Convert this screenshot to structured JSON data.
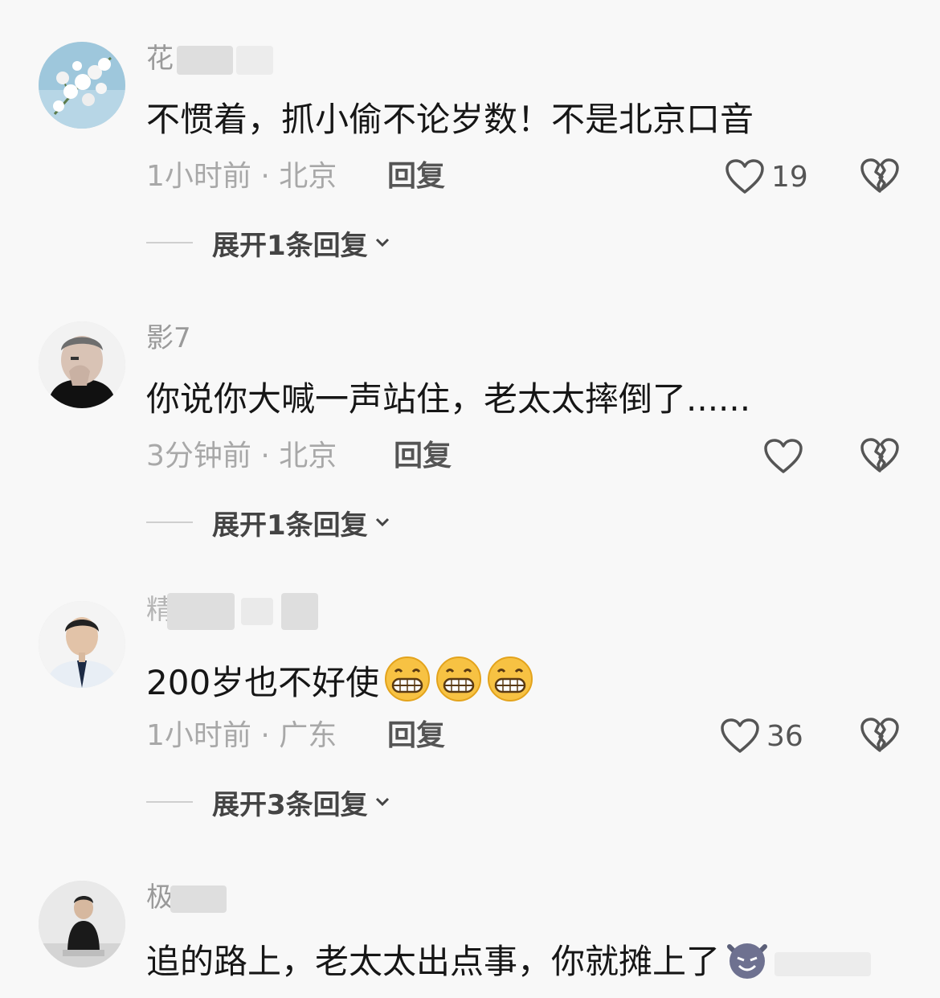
{
  "comments": [
    {
      "username": "花",
      "text": "不惯着，抓小偷不论岁数！不是北京口音",
      "time": "1小时前",
      "location": "北京",
      "reply_label": "回复",
      "likes": "19",
      "expand_label": "展开1条回复"
    },
    {
      "username": "影7",
      "text": "你说你大喊一声站住，老太太摔倒了......",
      "time": "3分钟前",
      "location": "北京",
      "reply_label": "回复",
      "likes": "",
      "expand_label": "展开1条回复"
    },
    {
      "username": "精",
      "text": "200岁也不好使",
      "emoji": "grinning-face",
      "emoji_count": 3,
      "time": "1小时前",
      "location": "广东",
      "reply_label": "回复",
      "likes": "36",
      "expand_label": "展开3条回复"
    },
    {
      "username": "极",
      "text": "追的路上，老太太出点事，你就摊上了",
      "emoji": "smiling-devil",
      "time": "",
      "location": "",
      "reply_label": "",
      "likes": "",
      "expand_label": ""
    }
  ],
  "icons": {
    "like": "heart-outline-icon",
    "dislike": "broken-heart-icon",
    "expand": "chevron-down-icon"
  },
  "colors": {
    "background": "#f8f8f8",
    "text": "#161616",
    "meta": "#a8a8a8",
    "emoji": "#f7c243"
  }
}
